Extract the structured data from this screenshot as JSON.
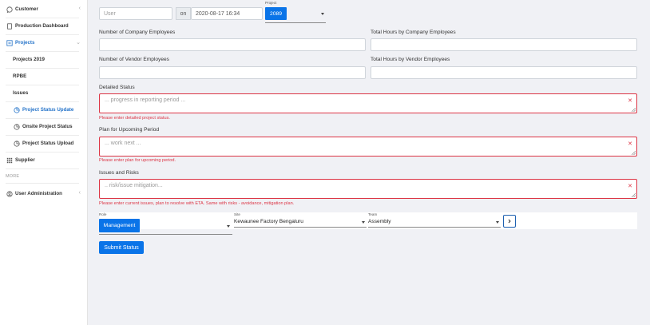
{
  "sidebar": {
    "items": [
      {
        "label": "Customer"
      },
      {
        "label": "Production Dashboard"
      },
      {
        "label": "Projects"
      },
      {
        "label": "Projects 2019"
      },
      {
        "label": "RPBE"
      },
      {
        "label": "Issues"
      },
      {
        "label": "Project Status Update"
      },
      {
        "label": "Onsite Project Status"
      },
      {
        "label": "Project Status Upload"
      },
      {
        "label": "Supplier"
      },
      {
        "label": "User Administration"
      }
    ],
    "more_label": "MORE",
    "active_color": "#2473c9"
  },
  "form": {
    "user_placeholder": "User",
    "on_label": "on",
    "datetime_value": "2020-08-17 16:34",
    "project_label": "Project",
    "project_value": "2089",
    "company_employees_label": "Number of Company Employees",
    "company_hours_label": "Total Hours by Company Employees",
    "vendor_employees_label": "Number of Vendor Employees",
    "vendor_hours_label": "Total Hours by Vendor Employees",
    "detailed_status_label": "Detailed Status",
    "detailed_status_placeholder": "... progress in reporting period ...",
    "detailed_status_error": "Please enter detailed project status.",
    "plan_label": "Plan for Upcoming Period",
    "plan_placeholder": "... work next ...",
    "plan_error": "Please enter plan for upcoming period.",
    "issues_label": "Issues and Risks",
    "issues_placeholder": ".. risk/issue mitigation...",
    "issues_error": "Please enter current issues, plan to resolve with ETA. Same with risks - avoidance, mitigation plan.",
    "role_label": "Role",
    "role_value": "Management",
    "site_label": "Site",
    "site_value": "Kewaunee Factory Bengaluru",
    "team_label": "Team",
    "team_value": "Assembly",
    "submit_label": "Submit Status",
    "accent_color": "#0a74e8",
    "error_color": "#dc3545"
  }
}
